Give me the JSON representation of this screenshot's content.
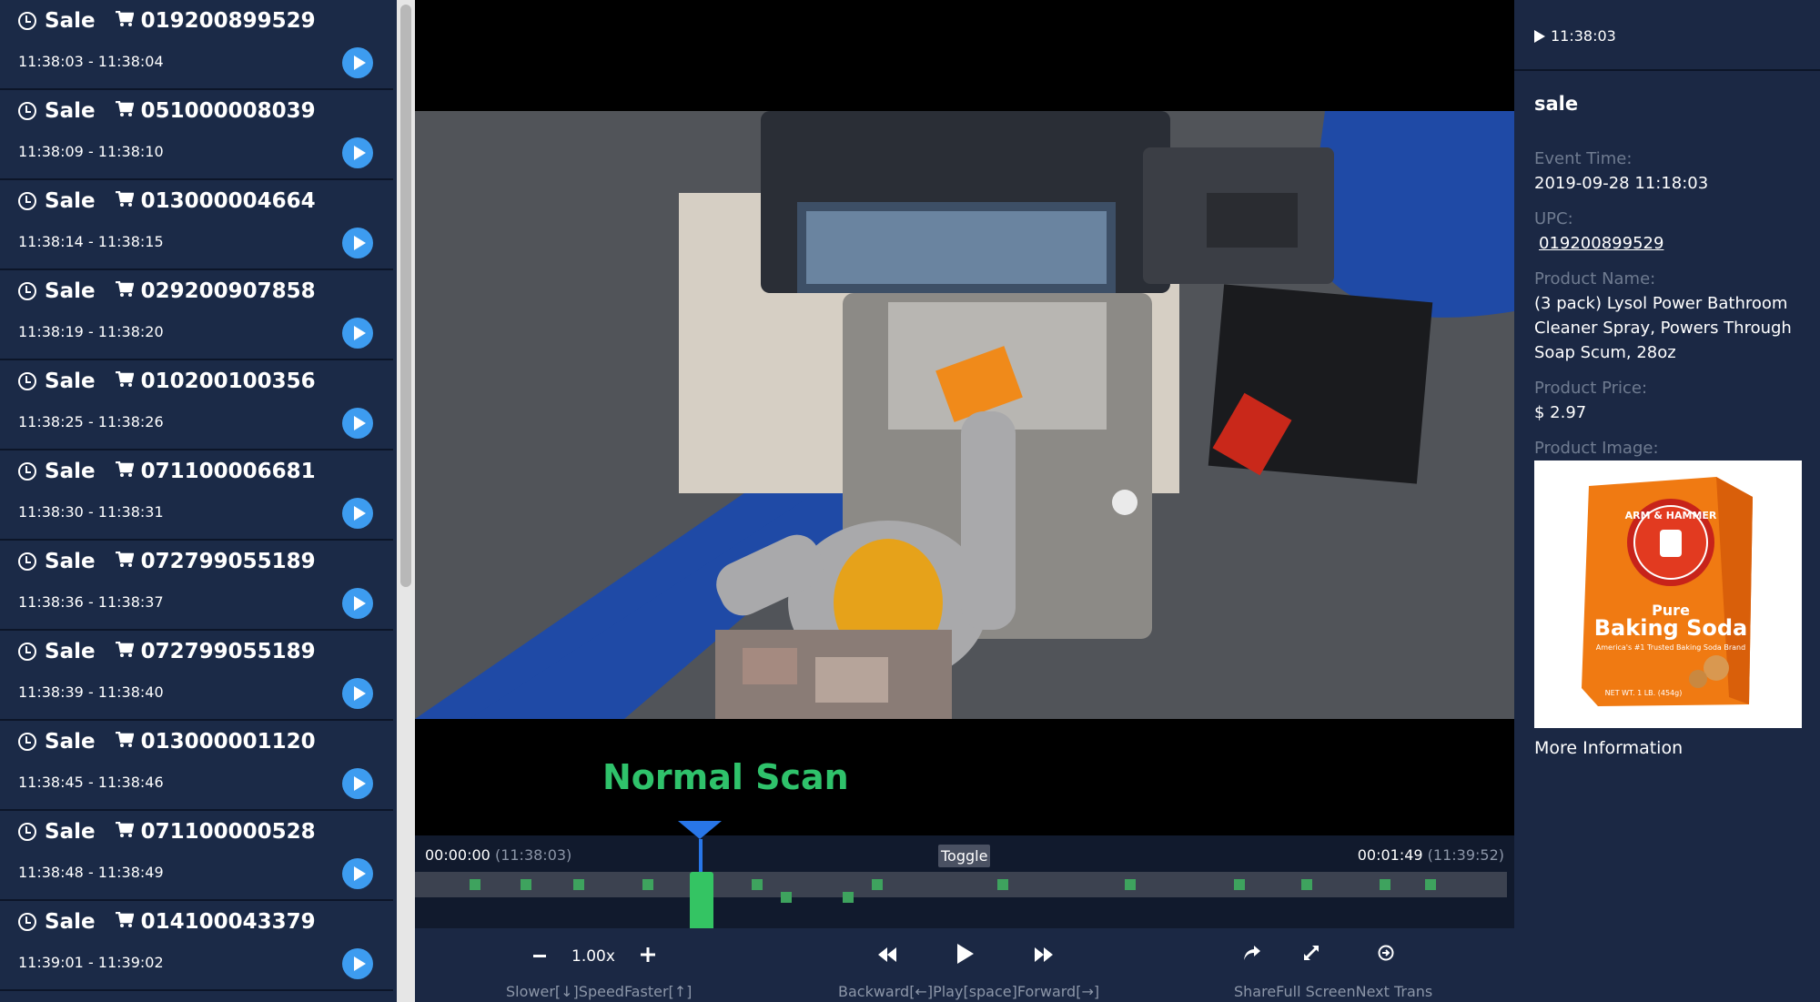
{
  "events": [
    {
      "type": "Sale",
      "upc": "019200899529",
      "time": "11:38:03 - 11:38:04"
    },
    {
      "type": "Sale",
      "upc": "051000008039",
      "time": "11:38:09 - 11:38:10"
    },
    {
      "type": "Sale",
      "upc": "013000004664",
      "time": "11:38:14 - 11:38:15"
    },
    {
      "type": "Sale",
      "upc": "029200907858",
      "time": "11:38:19 - 11:38:20"
    },
    {
      "type": "Sale",
      "upc": "010200100356",
      "time": "11:38:25 - 11:38:26"
    },
    {
      "type": "Sale",
      "upc": "071100006681",
      "time": "11:38:30 - 11:38:31"
    },
    {
      "type": "Sale",
      "upc": "072799055189",
      "time": "11:38:36 - 11:38:37"
    },
    {
      "type": "Sale",
      "upc": "072799055189",
      "time": "11:38:39 - 11:38:40"
    },
    {
      "type": "Sale",
      "upc": "013000001120",
      "time": "11:38:45 - 11:38:46"
    },
    {
      "type": "Sale",
      "upc": "071100000528",
      "time": "11:38:48 - 11:38:49"
    },
    {
      "type": "Sale",
      "upc": "014100043379",
      "time": "11:39:01 - 11:39:02"
    }
  ],
  "video": {
    "scan_status": "Normal Scan",
    "scan_status_color": "#2fc26b"
  },
  "timeline": {
    "start": "00:00:00",
    "start_clock": "(11:38:03)",
    "end": "00:01:49",
    "end_clock": "(11:39:52)",
    "toggle_label": "Toggle"
  },
  "controls": {
    "speed": "1.00x",
    "speed_labels": "Slower[↓]SpeedFaster[↑]",
    "playback_labels": "Backward[←]Play[space]Forward[→]",
    "action_labels": "ShareFull ScreenNext Trans"
  },
  "panel": {
    "header_time": "11:38:03",
    "title": "sale",
    "event_time_label": "Event Time:",
    "event_time": "2019-09-28 11:18:03",
    "upc_label": "UPC:",
    "upc": "019200899529",
    "product_name_label": "Product Name:",
    "product_name": "(3 pack) Lysol Power Bathroom Cleaner Spray, Powers Through Soap Scum, 28oz",
    "product_price_label": "Product Price:",
    "product_price": "$ 2.97",
    "product_image_label": "Product Image:",
    "more_info": "More Information",
    "image_brand": "ARM & HAMMER",
    "image_pure": "Pure",
    "image_product": "Baking Soda",
    "image_tagline": "America's #1 Trusted Baking Soda Brand",
    "image_weight": "NET WT. 1 LB. (454g)"
  },
  "colors": {
    "accent_blue": "#3d9cf0",
    "timeline_tick": "#3ea35e",
    "marker_green": "#34c463",
    "marker_pin": "#2876e8"
  }
}
